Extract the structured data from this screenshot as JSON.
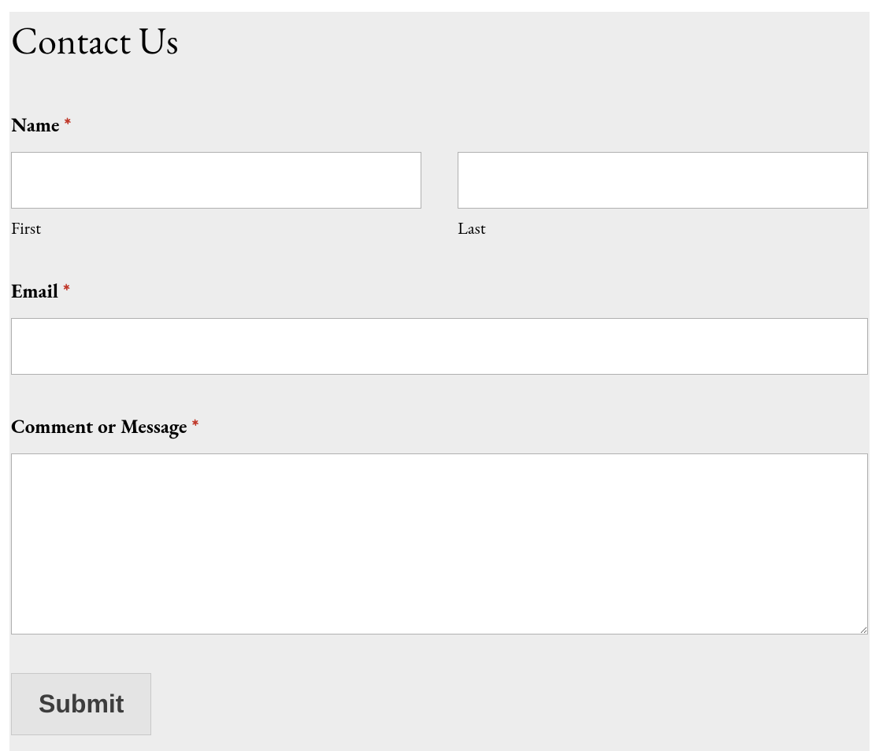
{
  "title": "Contact Us",
  "fields": {
    "name": {
      "label": "Name",
      "required_mark": "*",
      "first_sublabel": "First",
      "last_sublabel": "Last"
    },
    "email": {
      "label": "Email",
      "required_mark": "*"
    },
    "comment": {
      "label": "Comment or Message",
      "required_mark": "*"
    }
  },
  "submit": {
    "label": "Submit"
  }
}
